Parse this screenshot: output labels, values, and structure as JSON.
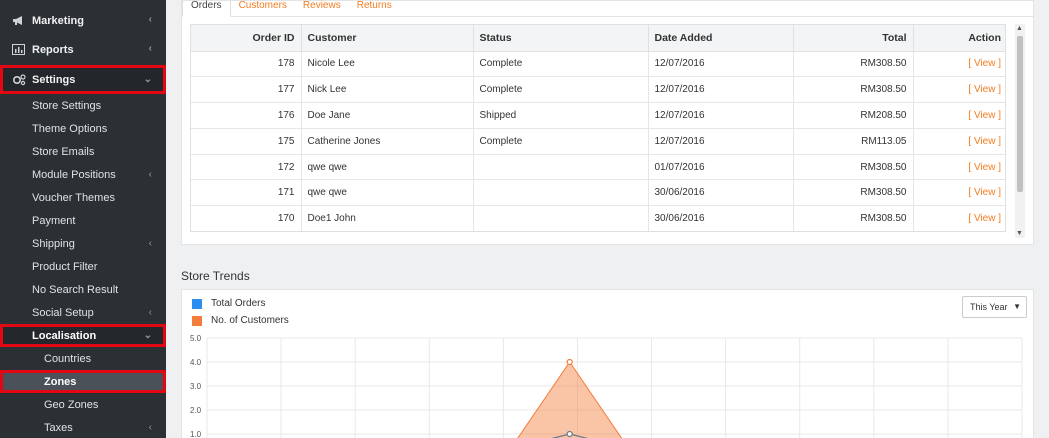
{
  "sidebar": {
    "top_items": [
      {
        "label": "Marketing",
        "icon": "megaphone-icon"
      },
      {
        "label": "Reports",
        "icon": "bar-chart-icon"
      },
      {
        "label": "Settings",
        "icon": "gears-icon"
      }
    ],
    "settings_items": [
      "Store Settings",
      "Theme Options",
      "Store Emails",
      "Module Positions",
      "Voucher Themes",
      "Payment",
      "Shipping",
      "Product Filter",
      "No Search Result",
      "Social Setup",
      "Localisation"
    ],
    "localisation_items": [
      "Countries",
      "Zones",
      "Geo Zones",
      "Taxes"
    ]
  },
  "orders": {
    "tabs": [
      "Orders",
      "Customers",
      "Reviews",
      "Returns"
    ],
    "columns": [
      "Order ID",
      "Customer",
      "Status",
      "Date Added",
      "Total",
      "Action"
    ],
    "rows": [
      {
        "id": "178",
        "customer": "Nicole Lee",
        "status": "Complete",
        "date": "12/07/2016",
        "total": "RM308.50",
        "action": "View"
      },
      {
        "id": "177",
        "customer": "Nick Lee",
        "status": "Complete",
        "date": "12/07/2016",
        "total": "RM308.50",
        "action": "View"
      },
      {
        "id": "176",
        "customer": "Doe Jane",
        "status": "Shipped",
        "date": "12/07/2016",
        "total": "RM208.50",
        "action": "View"
      },
      {
        "id": "175",
        "customer": "Catherine Jones",
        "status": "Complete",
        "date": "12/07/2016",
        "total": "RM113.05",
        "action": "View"
      },
      {
        "id": "172",
        "customer": "qwe qwe",
        "status": "",
        "date": "01/07/2016",
        "total": "RM308.50",
        "action": "View"
      },
      {
        "id": "171",
        "customer": "qwe qwe",
        "status": "",
        "date": "30/06/2016",
        "total": "RM308.50",
        "action": "View"
      },
      {
        "id": "170",
        "customer": "Doe1 John",
        "status": "",
        "date": "30/06/2016",
        "total": "RM308.50",
        "action": "View"
      }
    ]
  },
  "trends": {
    "title": "Store Trends",
    "legend": [
      {
        "label": "Total Orders",
        "color": "#2d8ef0"
      },
      {
        "label": "No. of Customers",
        "color": "#f47c3c"
      }
    ],
    "period_select": "This Year",
    "y_ticks": [
      "5.0",
      "4.0",
      "3.0",
      "2.0",
      "1.0"
    ],
    "peak_value": 4.0
  },
  "colors": {
    "accent": "#f47c20",
    "sidebar_bg": "#2b3035",
    "highlight": "#e30613"
  }
}
